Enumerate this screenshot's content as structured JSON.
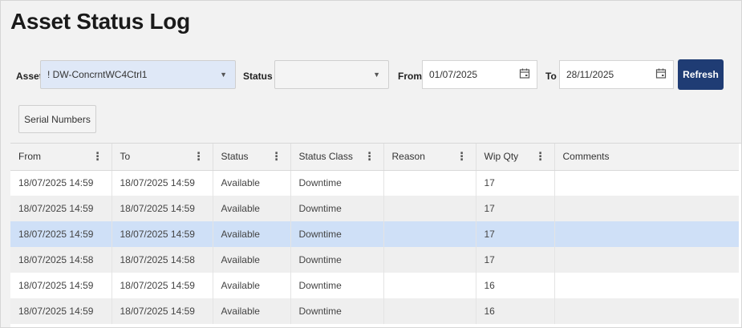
{
  "page": {
    "title": "Asset Status Log"
  },
  "filters": {
    "asset_label": "Asset",
    "asset_value": "! DW-ConcrntWC4Ctrl1",
    "status_label": "Status",
    "status_value": "",
    "from_label": "From",
    "from_value": "01/07/2025",
    "to_label": "To",
    "to_value": "28/11/2025",
    "refresh_label": "Refresh"
  },
  "toolbar": {
    "serial_numbers_label": "Serial Numbers"
  },
  "table": {
    "columns": [
      "From",
      "To",
      "Status",
      "Status Class",
      "Reason",
      "Wip Qty",
      "Comments"
    ],
    "rows": [
      {
        "from": "18/07/2025 14:59",
        "to": "18/07/2025 14:59",
        "status": "Available",
        "status_class": "Downtime",
        "reason": "",
        "wip_qty": "17",
        "comments": ""
      },
      {
        "from": "18/07/2025 14:59",
        "to": "18/07/2025 14:59",
        "status": "Available",
        "status_class": "Downtime",
        "reason": "",
        "wip_qty": "17",
        "comments": ""
      },
      {
        "from": "18/07/2025 14:59",
        "to": "18/07/2025 14:59",
        "status": "Available",
        "status_class": "Downtime",
        "reason": "",
        "wip_qty": "17",
        "comments": ""
      },
      {
        "from": "18/07/2025 14:58",
        "to": "18/07/2025 14:58",
        "status": "Available",
        "status_class": "Downtime",
        "reason": "",
        "wip_qty": "17",
        "comments": ""
      },
      {
        "from": "18/07/2025 14:59",
        "to": "18/07/2025 14:59",
        "status": "Available",
        "status_class": "Downtime",
        "reason": "",
        "wip_qty": "16",
        "comments": ""
      },
      {
        "from": "18/07/2025 14:59",
        "to": "18/07/2025 14:59",
        "status": "Available",
        "status_class": "Downtime",
        "reason": "",
        "wip_qty": "16",
        "comments": ""
      }
    ],
    "selected_row": 2
  },
  "colors": {
    "refresh_bg": "#1f3c74",
    "asset_select_bg": "#dfe8f7",
    "selected_row_bg": "#cfe0f7"
  },
  "icons": {
    "dropdown": "chevron-down-icon",
    "calendar": "calendar-icon",
    "column_menu": "kebab-menu-icon"
  }
}
